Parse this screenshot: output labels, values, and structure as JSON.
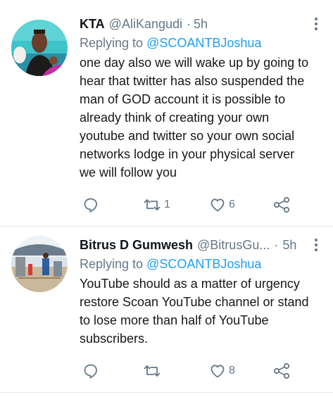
{
  "tweets": [
    {
      "author_name": "KTA",
      "handle": "@AliKangudi",
      "separator": "·",
      "time": "5h",
      "replying_prefix": "Replying to ",
      "replying_to": "@SCOANTBJoshua",
      "text": "one day also we will wake up by going to\nhear that twitter has also suspended the\nman of GOD account it is possible to\nalready think of creating your own\nyoutube and twitter so your own social\nnetworks lodge in your physical server\nwe will follow you",
      "retweets": "1",
      "likes": "6",
      "icons": [
        "reply-icon",
        "retweet-icon",
        "like-icon",
        "share-icon",
        "more-options-icon"
      ]
    },
    {
      "author_name": "Bitrus D Gumwesh",
      "handle": "@BitrusGu...",
      "separator": "·",
      "time": "5h",
      "replying_prefix": "Replying to ",
      "replying_to": "@SCOANTBJoshua",
      "text": "YouTube should as a matter of urgency\nrestore Scoan YouTube channel or stand\nto lose more than half of YouTube\nsubscribers.",
      "retweets": "",
      "likes": "8",
      "icons": [
        "reply-icon",
        "retweet-icon",
        "like-icon",
        "share-icon",
        "more-options-icon"
      ]
    }
  ],
  "colors": {
    "text": "#14171a",
    "secondary": "#657786",
    "mention": "#1da1f2",
    "divider": "#e1e8ed"
  }
}
